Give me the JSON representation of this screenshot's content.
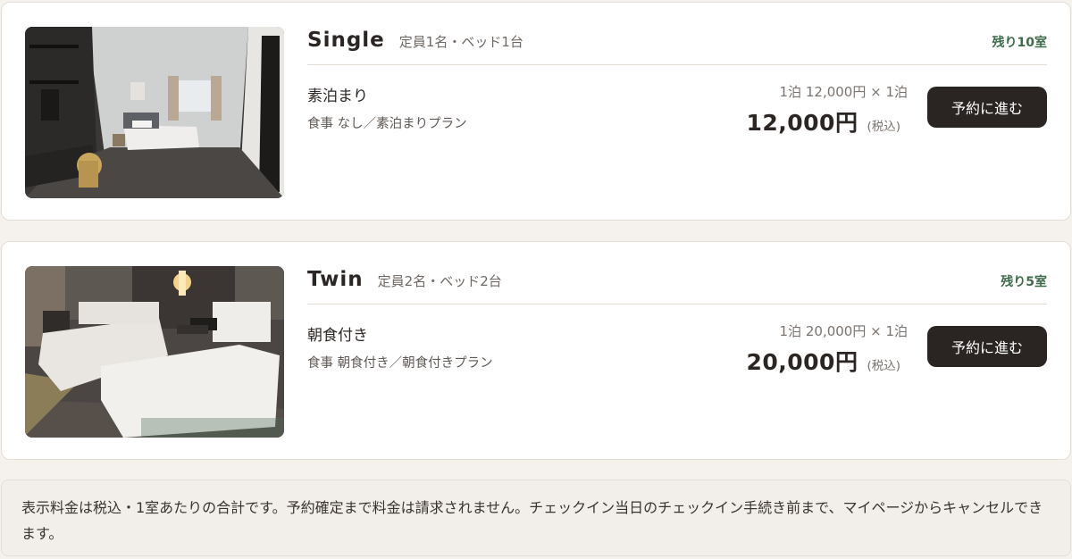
{
  "rooms": [
    {
      "name": "Single",
      "capacity": "定員1名・ベッド1台",
      "availability": "残り10室",
      "plan_name": "素泊まり",
      "plan_meal": "食事 なし／素泊まりプラン",
      "price_detail": "1泊 12,000円 × 1泊",
      "price_total": "12,000円",
      "tax_note": "(税込)",
      "book_label": "予約に進む"
    },
    {
      "name": "Twin",
      "capacity": "定員2名・ベッド2台",
      "availability": "残り5室",
      "plan_name": "朝食付き",
      "plan_meal": "食事 朝食付き／朝食付きプラン",
      "price_detail": "1泊 20,000円 × 1泊",
      "price_total": "20,000円",
      "tax_note": "(税込)",
      "book_label": "予約に進む"
    }
  ],
  "notice": "表示料金は税込・1室あたりの合計です。予約確定まで料金は請求されません。チェックイン当日のチェックイン手続き前まで、マイページからキャンセルできます。",
  "colors": {
    "accent_green": "#3d6b4a",
    "button_bg": "#2a2522",
    "page_bg": "#f5f2ee"
  }
}
